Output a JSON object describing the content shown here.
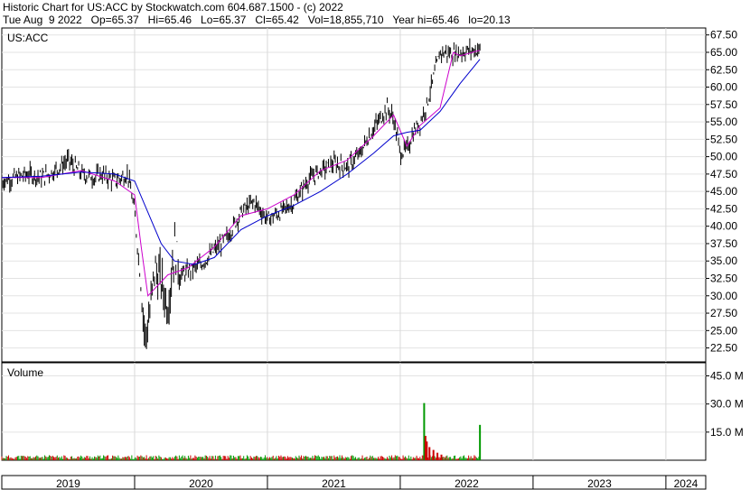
{
  "header": {
    "line1": "Historic Chart for US:ACC by Stockwatch.com 604.687.1500 - (c) 2022",
    "line2": "Tue Aug  9 2022   Op=65.37   Hi=65.46   Lo=65.37   Cl=65.42   Vol=18,855,710   Year hi=65.46   lo=20.13"
  },
  "price_panel": {
    "symbol_label": "US:ACC"
  },
  "volume_panel": {
    "label": "Volume"
  },
  "chart_data": {
    "type": "line",
    "title": "Historic Chart for US:ACC",
    "price": {
      "y_ticks": [
        "67.50",
        "65.00",
        "62.50",
        "60.00",
        "57.50",
        "55.00",
        "52.50",
        "50.00",
        "47.50",
        "45.00",
        "42.50",
        "40.00",
        "37.50",
        "35.00",
        "32.50",
        "30.00",
        "27.50",
        "25.00",
        "22.50"
      ],
      "ylim": [
        20.5,
        68.5
      ],
      "series": [
        {
          "type": "hlc_bars",
          "color": "#000000",
          "x": [
            2019.0,
            2019.1,
            2019.2,
            2019.3,
            2019.4,
            2019.5,
            2019.6,
            2019.7,
            2019.75,
            2019.85,
            2019.95,
            2020.0,
            2020.05,
            2020.08,
            2020.12,
            2020.15,
            2020.2,
            2020.25,
            2020.3,
            2020.35,
            2020.4,
            2020.5,
            2020.6,
            2020.7,
            2020.8,
            2020.9,
            2021.0,
            2021.1,
            2021.2,
            2021.3,
            2021.4,
            2021.5,
            2021.6,
            2021.7,
            2021.75,
            2021.8,
            2021.85,
            2021.9,
            2021.95,
            2022.0,
            2022.05,
            2022.1,
            2022.15,
            2022.2,
            2022.3,
            2022.4,
            2022.5,
            2022.6
          ],
          "values": [
            46.5,
            47.0,
            47.5,
            47.0,
            48.0,
            49.5,
            47.5,
            47.0,
            47.5,
            46.5,
            47.5,
            42.0,
            31.0,
            24.0,
            28.0,
            34.0,
            32.0,
            28.5,
            37.0,
            33.0,
            33.5,
            34.5,
            36.5,
            38.5,
            42.0,
            43.5,
            41.0,
            42.0,
            43.5,
            46.5,
            48.0,
            49.0,
            48.5,
            50.5,
            52.5,
            54.0,
            55.5,
            57.0,
            55.5,
            50.5,
            51.0,
            53.5,
            55.0,
            57.5,
            65.0,
            64.8,
            65.2,
            65.42
          ]
        },
        {
          "name": "",
          "type": "line",
          "color": "#cc00cc",
          "x": [
            2019.0,
            2019.3,
            2019.6,
            2019.85,
            2020.0,
            2020.05,
            2020.1,
            2020.15,
            2020.25,
            2020.4,
            2020.6,
            2020.8,
            2021.0,
            2021.2,
            2021.4,
            2021.6,
            2021.8,
            2021.95,
            2022.05,
            2022.15,
            2022.3,
            2022.4,
            2022.45,
            2022.6
          ],
          "values": [
            47.0,
            47.0,
            48.0,
            46.5,
            44.5,
            37.0,
            30.0,
            31.0,
            33.0,
            34.0,
            37.0,
            41.5,
            42.5,
            44.5,
            48.0,
            49.5,
            53.0,
            56.0,
            51.5,
            54.5,
            57.0,
            65.0,
            64.5,
            65.3
          ]
        },
        {
          "name": "",
          "type": "line",
          "color": "#0000cc",
          "x": [
            2019.0,
            2019.3,
            2019.6,
            2019.85,
            2020.0,
            2020.1,
            2020.2,
            2020.3,
            2020.45,
            2020.6,
            2020.8,
            2021.0,
            2021.2,
            2021.4,
            2021.6,
            2021.8,
            2021.95,
            2022.05,
            2022.15,
            2022.3,
            2022.45,
            2022.6
          ],
          "values": [
            47.0,
            47.2,
            47.8,
            47.5,
            46.5,
            42.0,
            37.5,
            35.0,
            34.5,
            35.5,
            39.5,
            41.5,
            43.0,
            45.0,
            47.5,
            50.5,
            53.0,
            53.5,
            53.8,
            56.5,
            60.5,
            64.0
          ]
        }
      ]
    },
    "volume": {
      "label": "Volume",
      "y_ticks": [
        "45.0 M",
        "30.0 M",
        "15.0 M"
      ],
      "ylim": [
        0,
        52
      ],
      "bars": [
        {
          "x": 2022.18,
          "value": 30.5
        },
        {
          "x": 2022.19,
          "value": 13.0
        },
        {
          "x": 2022.2,
          "value": 10.0
        },
        {
          "x": 2022.22,
          "value": 7.0
        },
        {
          "x": 2022.25,
          "value": 5.5
        },
        {
          "x": 2022.28,
          "value": 4.0
        },
        {
          "x": 2022.31,
          "value": 3.0
        },
        {
          "x": 2022.6,
          "value": 18.86
        }
      ],
      "baseline_value": 1.5
    },
    "x_axis": {
      "labels": [
        "2019",
        "2020",
        "2021",
        "2022",
        "2023",
        "2024"
      ],
      "xlim": [
        2019.0,
        2024.3
      ]
    }
  }
}
